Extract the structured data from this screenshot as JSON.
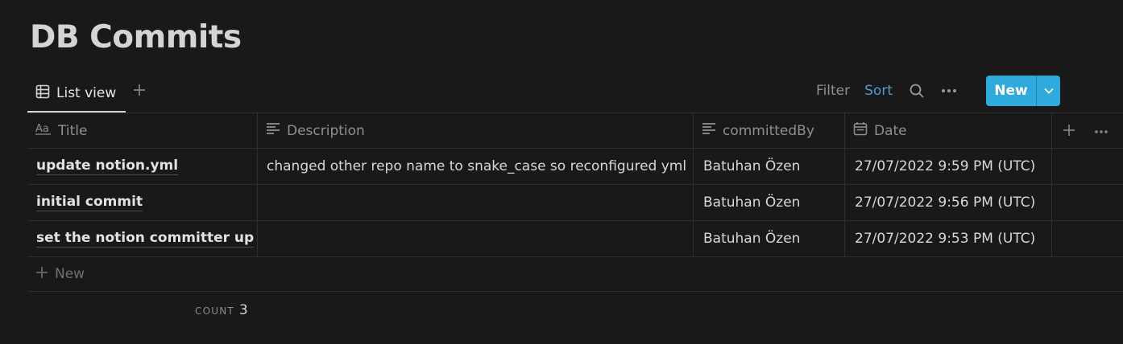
{
  "page": {
    "title": "DB Commits"
  },
  "views": {
    "active_label": "List view",
    "add_icon": "plus-icon"
  },
  "toolbar": {
    "filter_label": "Filter",
    "sort_label": "Sort",
    "new_label": "New",
    "accent": "#2eaadc",
    "sort_color": "#529cca"
  },
  "table": {
    "columns": [
      {
        "label": "Title",
        "icon": "title-aa-icon"
      },
      {
        "label": "Description",
        "icon": "text-lines-icon"
      },
      {
        "label": "committedBy",
        "icon": "text-lines-icon"
      },
      {
        "label": "Date",
        "icon": "calendar-icon"
      }
    ],
    "rows": [
      {
        "title": "update notion.yml",
        "description": "changed other repo name to snake_case so reconfigured yml",
        "committedBy": "Batuhan Özen",
        "date": "27/07/2022 9:59 PM (UTC)"
      },
      {
        "title": "initial commit",
        "description": "",
        "committedBy": "Batuhan Özen",
        "date": "27/07/2022 9:56 PM (UTC)"
      },
      {
        "title": "set the notion committer up",
        "description": "",
        "committedBy": "Batuhan Özen",
        "date": "27/07/2022 9:53 PM (UTC)"
      }
    ],
    "new_row_label": "New",
    "count_label": "COUNT",
    "count_value": "3"
  }
}
